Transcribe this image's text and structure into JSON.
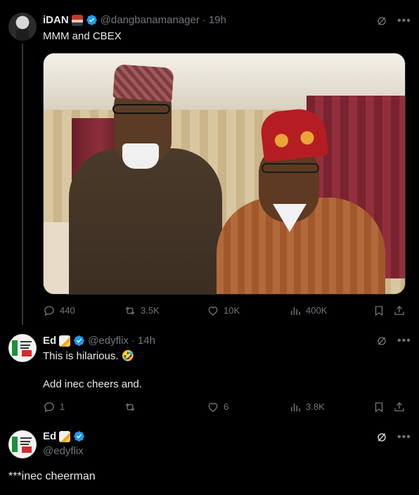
{
  "post_main": {
    "display_name": "iDAN",
    "handle": "@dangbanamanager",
    "dot": "·",
    "time": "19h",
    "text": "MMM and CBEX",
    "stats": {
      "replies": "440",
      "reposts": "3.5K",
      "likes": "10K",
      "views": "400K"
    }
  },
  "reply_1": {
    "display_name": "Ed",
    "handle": "@edyflix",
    "dot": "·",
    "time": "14h",
    "text_line_1": "This is hilarious. 🤣",
    "text_line_2": "Add inec cheers and.",
    "stats": {
      "replies": "1",
      "reposts": "",
      "likes": "6",
      "views": "3.8K"
    }
  },
  "reply_2": {
    "display_name": "Ed",
    "handle": "@edyflix",
    "text": "***inec cheerman"
  },
  "colors": {
    "background": "#000000",
    "text_primary": "#e7e9ea",
    "text_secondary": "#71767b",
    "verified_blue": "#1d9bf0",
    "thread_line": "#333639"
  },
  "icons": [
    "verified-badge-icon",
    "grok-icon",
    "more-icon",
    "reply-icon",
    "repost-icon",
    "like-icon",
    "views-icon",
    "bookmark-icon",
    "share-icon"
  ]
}
